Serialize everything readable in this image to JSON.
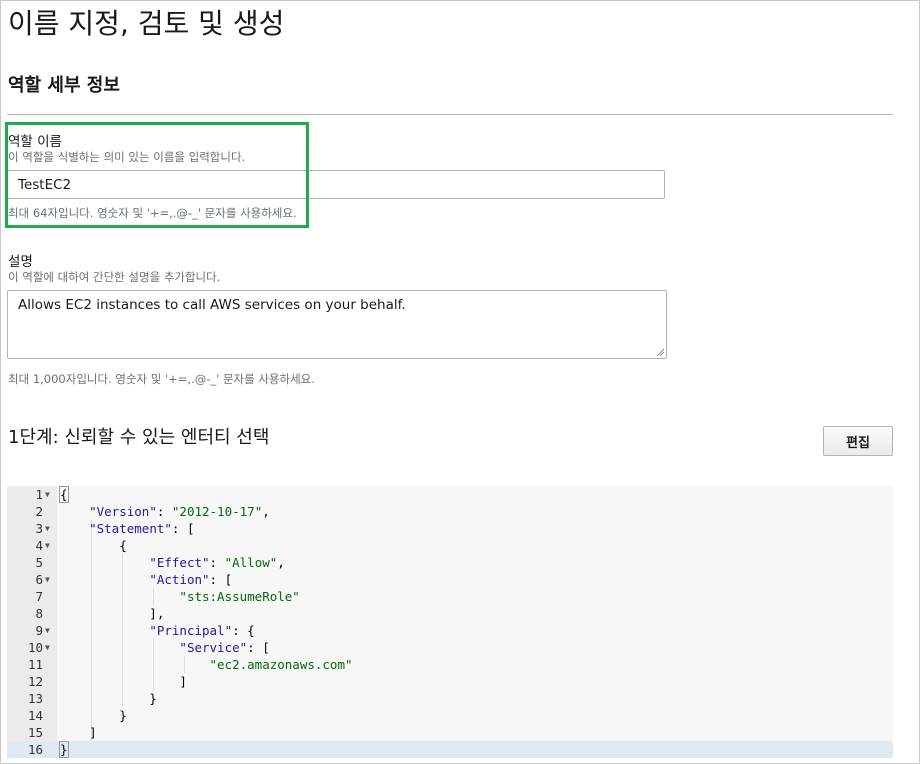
{
  "page": {
    "title": "이름 지정, 검토 및 생성"
  },
  "role_details": {
    "section_title": "역할 세부 정보",
    "name": {
      "label": "역할 이름",
      "hint": "이 역할을 식별하는 의미 있는 이름을 입력합니다.",
      "value": "TestEC2",
      "constraint": "최대 64자입니다. 영숫자 및 '+=,.@-_' 문자를 사용하세요."
    },
    "description": {
      "label": "설명",
      "hint": "이 역할에 대하여 간단한 설명을 추가합니다.",
      "value": "Allows EC2 instances to call AWS services on your behalf.",
      "constraint": "최대 1,000자입니다. 영숫자 및 '+=,.@-_' 문자를 사용하세요."
    }
  },
  "step1": {
    "title": "1단계: 신뢰할 수 있는 엔터티 선택",
    "edit_label": "편집"
  },
  "editor": {
    "lines": [
      {
        "n": "1",
        "fold": true
      },
      {
        "n": "2"
      },
      {
        "n": "3",
        "fold": true
      },
      {
        "n": "4",
        "fold": true
      },
      {
        "n": "5"
      },
      {
        "n": "6",
        "fold": true
      },
      {
        "n": "7"
      },
      {
        "n": "8"
      },
      {
        "n": "9",
        "fold": true
      },
      {
        "n": "10",
        "fold": true
      },
      {
        "n": "11"
      },
      {
        "n": "12"
      },
      {
        "n": "13"
      },
      {
        "n": "14"
      },
      {
        "n": "15"
      },
      {
        "n": "16"
      }
    ],
    "tokens": {
      "version_key": "\"Version\"",
      "version_val": "\"2012-10-17\"",
      "statement_key": "\"Statement\"",
      "effect_key": "\"Effect\"",
      "effect_val": "\"Allow\"",
      "action_key": "\"Action\"",
      "action_val": "\"sts:AssumeRole\"",
      "principal_key": "\"Principal\"",
      "service_key": "\"Service\"",
      "service_val": "\"ec2.amazonaws.com\""
    }
  },
  "colors": {
    "highlight": "#1faa4c",
    "json_key": "#1a1aa6",
    "json_string": "#036a07"
  }
}
